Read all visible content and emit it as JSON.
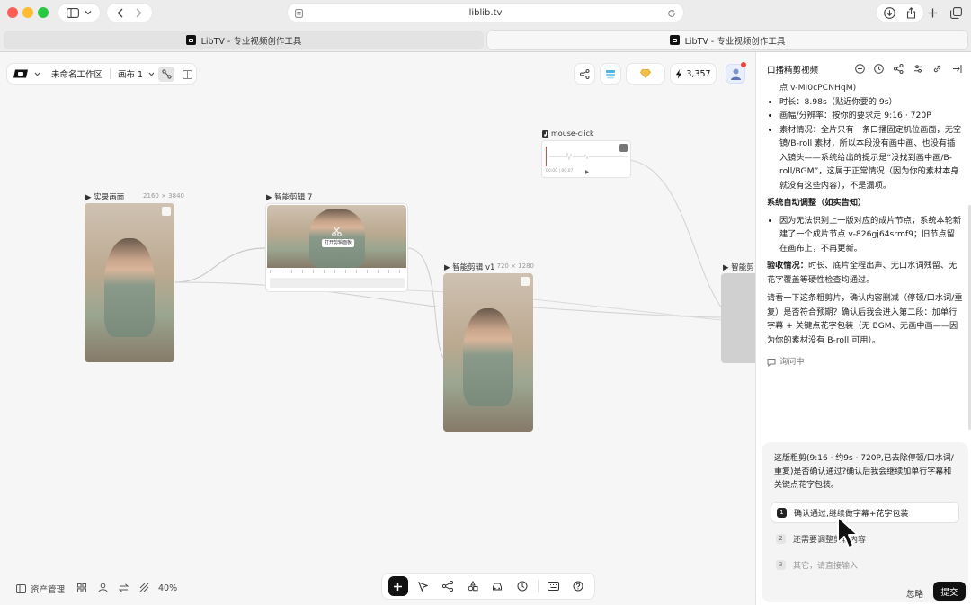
{
  "browser": {
    "address": "liblib.tv",
    "tabs": [
      {
        "label": "LibTV - 专业视频创作工具",
        "active": false
      },
      {
        "label": "LibTV - 专业视频创作工具",
        "active": true
      }
    ]
  },
  "workspace": {
    "name": "未命名工作区",
    "canvas": "画布 1",
    "credits": "3,357"
  },
  "nodes": {
    "source": {
      "label": "▶ 实录画面",
      "dim": "2160 × 3840"
    },
    "edit7": {
      "label": "▶ 智能剪辑 7",
      "hint": "打开剪辑面板"
    },
    "editv1": {
      "label": "▶ 智能剪辑 v1",
      "dim": "720 × 1280"
    },
    "audio": {
      "label": "mouse-click",
      "time": "00:00 | 00:07"
    },
    "partial": {
      "label": "▶ 智能剪"
    }
  },
  "footer": {
    "assets": "资产管理",
    "zoom": "40%"
  },
  "chat": {
    "title": "口播精剪视频",
    "truncated": "点 v-MI0cPCNHqM)",
    "bullets": [
      "时长：8.98s（贴近你要的 9s）",
      "画幅/分辨率：按你的要求走 9:16 · 720P",
      "素材情况：全片只有一条口播固定机位画面，无空镜/B-roll 素材，所以本段没有画中画、也没有插入镜头——系统给出的提示是“没找到画中画/B-roll/BGM”，这属于正常情况（因为你的素材本身就没有这些内容），不是漏项。"
    ],
    "section_title": "系统自动调整（如实告知）",
    "section_bullet": "因为无法识别上一版对应的成片节点，系统本轮新建了一个成片节点 v-826gj64srmf9；旧节点留在画布上，不再更新。",
    "accept_label": "验收情况：",
    "accept_text": "时长、底片全程出声、无口水词残留、无花字覆盖等硬性检查均通过。",
    "closing": "请看一下这条粗剪片，确认内容删减（停顿/口水词/重复）是否符合预期？确认后我会进入第二段：加单行字幕 + 关键点花字包装（无 BGM、无画中画——因为你的素材没有 B-roll 可用）。",
    "status": "询问中",
    "question": "这版粗剪(9:16 · 约9s · 720P,已去除停顿/口水词/重复)是否确认通过?确认后我会继续加单行字幕和关键点花字包装。",
    "options": [
      {
        "num": "1",
        "text": "确认通过,继续做字幕+花字包装"
      },
      {
        "num": "2",
        "text": "还需要调整剪辑内容"
      },
      {
        "num": "3",
        "text": "其它，请直接输入"
      }
    ],
    "ignore": "忽略",
    "submit": "提交"
  }
}
